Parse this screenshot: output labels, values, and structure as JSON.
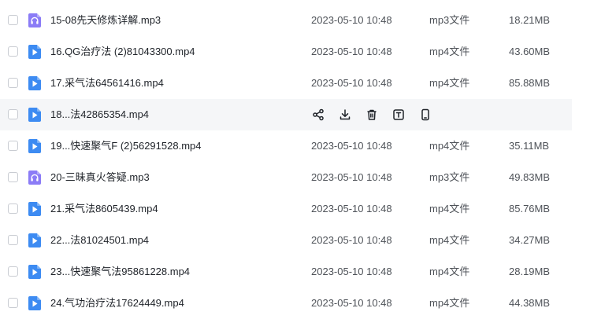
{
  "colors": {
    "mp4_icon": "#3d8bf2",
    "mp3_icon": "#8b7cf6",
    "hover_row_bg": "#f5f6f8",
    "action_icon": "#1f2329"
  },
  "hover_actions": [
    {
      "name": "share-icon"
    },
    {
      "name": "download-icon"
    },
    {
      "name": "delete-icon"
    },
    {
      "name": "text-info-icon"
    },
    {
      "name": "mobile-icon"
    }
  ],
  "files": [
    {
      "name": "15-08先天修炼详解.mp3",
      "date": "2023-05-10 10:48",
      "type": "mp3文件",
      "size": "18.21MB",
      "icon": "audio-file-icon",
      "hover": false
    },
    {
      "name": "16.QG治疗法 (2)81043300.mp4",
      "date": "2023-05-10 10:48",
      "type": "mp4文件",
      "size": "43.60MB",
      "icon": "video-file-icon",
      "hover": false
    },
    {
      "name": "17.采气法64561416.mp4",
      "date": "2023-05-10 10:48",
      "type": "mp4文件",
      "size": "85.88MB",
      "icon": "video-file-icon",
      "hover": false
    },
    {
      "name": "18...法42865354.mp4",
      "date": "",
      "type": "",
      "size": "",
      "icon": "video-file-icon",
      "hover": true
    },
    {
      "name": "19...快速聚气F (2)56291528.mp4",
      "date": "2023-05-10 10:48",
      "type": "mp4文件",
      "size": "35.11MB",
      "icon": "video-file-icon",
      "hover": false
    },
    {
      "name": "20-三昧真火答疑.mp3",
      "date": "2023-05-10 10:48",
      "type": "mp3文件",
      "size": "49.83MB",
      "icon": "audio-file-icon",
      "hover": false
    },
    {
      "name": "21.采气法8605439.mp4",
      "date": "2023-05-10 10:48",
      "type": "mp4文件",
      "size": "85.76MB",
      "icon": "video-file-icon",
      "hover": false
    },
    {
      "name": "22...法81024501.mp4",
      "date": "2023-05-10 10:48",
      "type": "mp4文件",
      "size": "34.27MB",
      "icon": "video-file-icon",
      "hover": false
    },
    {
      "name": "23...快速聚气法95861228.mp4",
      "date": "2023-05-10 10:48",
      "type": "mp4文件",
      "size": "28.19MB",
      "icon": "video-file-icon",
      "hover": false
    },
    {
      "name": "24.气功治疗法17624449.mp4",
      "date": "2023-05-10 10:48",
      "type": "mp4文件",
      "size": "44.38MB",
      "icon": "video-file-icon",
      "hover": false
    }
  ]
}
